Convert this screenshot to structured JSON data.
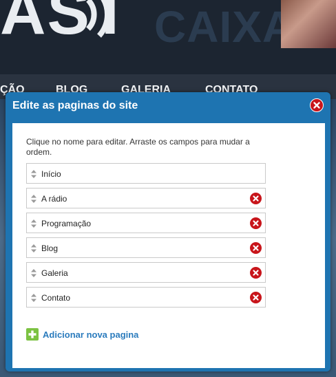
{
  "background": {
    "logo_text": "AST",
    "brand_text": "CAIXA",
    "nav": [
      {
        "label": "ÇÃO"
      },
      {
        "label": "BLOG"
      },
      {
        "label": "GALERIA"
      },
      {
        "label": "CONTATO"
      }
    ]
  },
  "modal": {
    "title": "Edite as paginas do site",
    "instructions": "Clique no nome para editar. Arraste os campos para mudar a ordem.",
    "pages": [
      {
        "label": "Início",
        "deletable": false
      },
      {
        "label": "A rádio",
        "deletable": true
      },
      {
        "label": "Programação",
        "deletable": true
      },
      {
        "label": "Blog",
        "deletable": true
      },
      {
        "label": "Galeria",
        "deletable": true
      },
      {
        "label": "Contato",
        "deletable": true
      }
    ],
    "add_page_label": "Adicionar nova pagina"
  },
  "colors": {
    "modal_blue": "#1e74b1",
    "delete_red": "#c8151b",
    "add_green": "#7cc242",
    "link_blue": "#2a7bbd"
  },
  "icons": {
    "close": "close-icon",
    "drag": "drag-handle-icon",
    "delete": "delete-icon",
    "add": "plus-icon"
  }
}
